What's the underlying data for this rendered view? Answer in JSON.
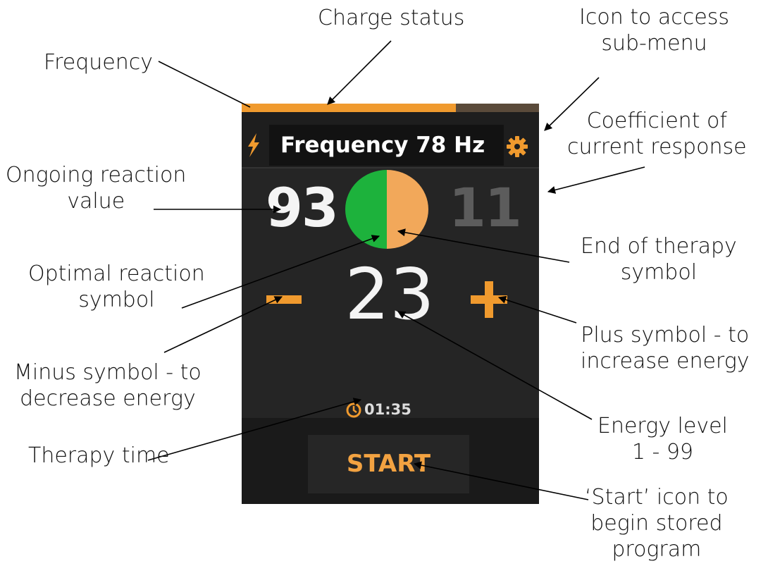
{
  "device": {
    "charge_fraction": 0.72,
    "frequency_text": "Frequency 78 Hz",
    "reaction_value": "93",
    "coefficient_value": "11",
    "energy_level": "23",
    "therapy_time": "01:35",
    "start_label": "START",
    "colors": {
      "accent": "#f09a2e",
      "optimal_green": "#1db23c",
      "end_orange": "#f2a85a",
      "background": "#1c1c1c"
    },
    "icons": {
      "bolt": "bolt-icon",
      "settings": "gear-icon",
      "minus": "minus-icon",
      "plus": "plus-icon",
      "timer": "clock-icon"
    }
  },
  "callouts": {
    "frequency": "Frequency",
    "charge_status": "Charge status",
    "submenu_icon": "Icon to access\nsub-menu",
    "coefficient": "Coefficient of\ncurrent response",
    "ongoing_reaction": "Ongoing reaction\nvalue",
    "end_of_therapy": "End of therapy\nsymbol",
    "optimal_reaction": "Optimal reaction\nsymbol",
    "plus_symbol": "Plus symbol - to\nincrease energy",
    "minus_symbol": "Minus symbol - to\ndecrease energy",
    "energy_level": "Energy level\n1 - 99",
    "therapy_time": "Therapy time",
    "start_icon": "‘Start’ icon to\nbegin stored\nprogram"
  }
}
